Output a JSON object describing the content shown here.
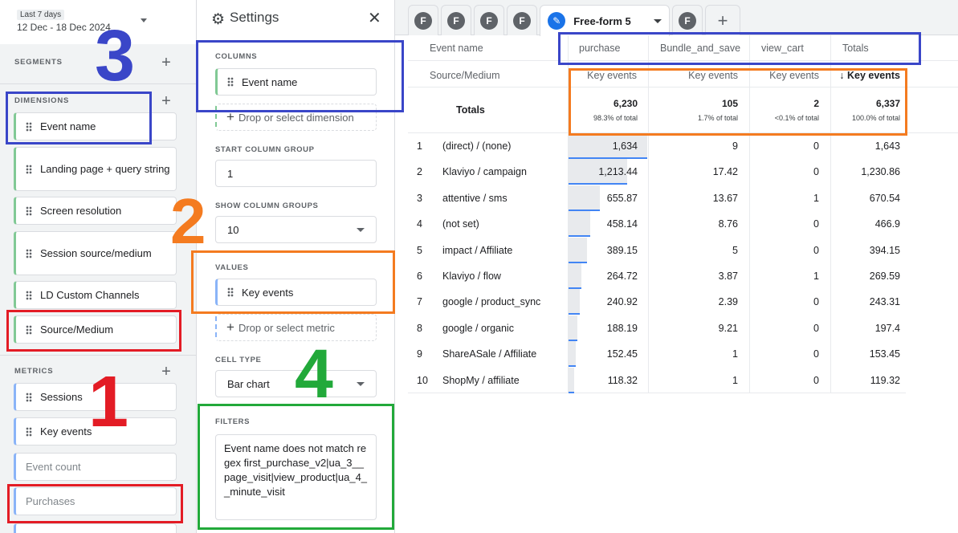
{
  "date": {
    "label": "Last 7 days",
    "range": "12 Dec - 18 Dec 2024"
  },
  "variables": {
    "segments_title": "SEGMENTS",
    "dimensions_title": "DIMENSIONS",
    "metrics_title": "METRICS",
    "dimensions": [
      "Event name",
      "Landing page + query string",
      "Screen resolution",
      "Session source/medium",
      "LD Custom Channels",
      "Source/Medium"
    ],
    "metrics": [
      "Sessions",
      "Key events"
    ],
    "metrics_unavailable": [
      "Event count",
      "Purchases"
    ]
  },
  "settings": {
    "title": "Settings",
    "columns_label": "COLUMNS",
    "columns_value": "Event name",
    "drop_dimension": "Drop or select dimension",
    "start_column_group_label": "START COLUMN GROUP",
    "start_column_group_value": "1",
    "show_column_groups_label": "SHOW COLUMN GROUPS",
    "show_column_groups_value": "10",
    "values_label": "VALUES",
    "values_value": "Key events",
    "drop_metric": "Drop or select metric",
    "cell_type_label": "CELL TYPE",
    "cell_type_value": "Bar chart",
    "filters_label": "FILTERS",
    "filter_text": "Event name does not match regex first_purchase_v2|ua_3__page_visit|view_product|ua_4__minute_visit"
  },
  "tabs": {
    "collapsed": [
      "F",
      "F",
      "F",
      "F"
    ],
    "active": "Free-form 5",
    "after": [
      "F"
    ]
  },
  "table": {
    "row_dimension_header": "Event name",
    "row_dimension_subheader": "Source/Medium",
    "columns": [
      "purchase",
      "Bundle_and_save",
      "view_cart",
      "Totals"
    ],
    "metric_label": "Key events",
    "sorted_metric_label": "↓ Key events",
    "totals_label": "Totals",
    "totals": [
      "6,230",
      "105",
      "2",
      "6,337"
    ],
    "totals_pct": [
      "98.3% of total",
      "1.7% of total",
      "<0.1% of total",
      "100.0% of total"
    ],
    "rows": [
      {
        "n": "1",
        "source": "(direct) / (none)",
        "purchase": "1,634",
        "purchase_value": 1634,
        "bundle": "9",
        "view_cart": "0",
        "total": "1,643"
      },
      {
        "n": "2",
        "source": "Klaviyo / campaign",
        "purchase": "1,213.44",
        "purchase_value": 1213.44,
        "bundle": "17.42",
        "view_cart": "0",
        "total": "1,230.86"
      },
      {
        "n": "3",
        "source": "attentive / sms",
        "purchase": "655.87",
        "purchase_value": 655.87,
        "bundle": "13.67",
        "view_cart": "1",
        "total": "670.54"
      },
      {
        "n": "4",
        "source": "(not set)",
        "purchase": "458.14",
        "purchase_value": 458.14,
        "bundle": "8.76",
        "view_cart": "0",
        "total": "466.9"
      },
      {
        "n": "5",
        "source": "impact / Affiliate",
        "purchase": "389.15",
        "purchase_value": 389.15,
        "bundle": "5",
        "view_cart": "0",
        "total": "394.15"
      },
      {
        "n": "6",
        "source": "Klaviyo / flow",
        "purchase": "264.72",
        "purchase_value": 264.72,
        "bundle": "3.87",
        "view_cart": "1",
        "total": "269.59"
      },
      {
        "n": "7",
        "source": "google / product_sync",
        "purchase": "240.92",
        "purchase_value": 240.92,
        "bundle": "2.39",
        "view_cart": "0",
        "total": "243.31"
      },
      {
        "n": "8",
        "source": "google / organic",
        "purchase": "188.19",
        "purchase_value": 188.19,
        "bundle": "9.21",
        "view_cart": "0",
        "total": "197.4"
      },
      {
        "n": "9",
        "source": "ShareASale / Affiliate",
        "purchase": "152.45",
        "purchase_value": 152.45,
        "bundle": "1",
        "view_cart": "0",
        "total": "153.45"
      },
      {
        "n": "10",
        "source": "ShopMy / affiliate",
        "purchase": "118.32",
        "purchase_value": 118.32,
        "bundle": "1",
        "view_cart": "0",
        "total": "119.32"
      }
    ]
  },
  "annotations": {
    "labels": [
      "1",
      "2",
      "3",
      "4"
    ],
    "colors": {
      "1": "#e31c25",
      "2": "#f47b20",
      "3": "#3a46c8",
      "4": "#22a93a"
    }
  }
}
